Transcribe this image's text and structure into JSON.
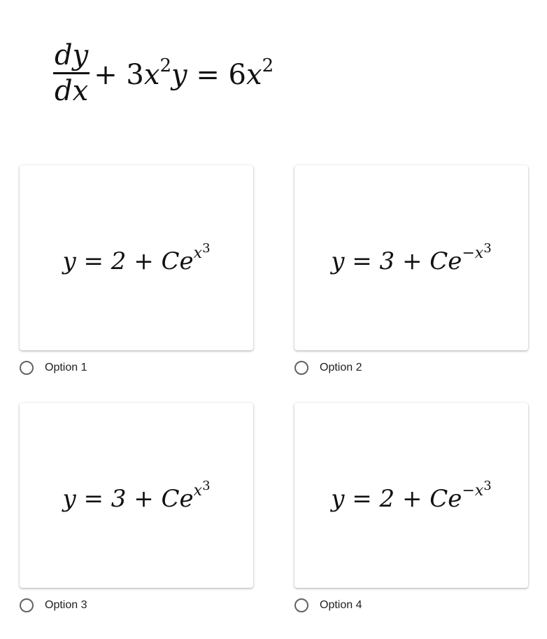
{
  "question": {
    "numerator": "dy",
    "denominator": "dx",
    "plus": "+ 3",
    "x1": "x",
    "exp1": "2",
    "y1": "y",
    "equals": " = 6",
    "x2": "x",
    "exp2": "2"
  },
  "options": [
    {
      "label": "Option 1",
      "formula_base": "y = 2 + Ce",
      "formula_exp_sign": "",
      "formula_exp_var": "x",
      "formula_exp_pow": "3",
      "selected": false
    },
    {
      "label": "Option 2",
      "formula_base": "y = 3 + Ce",
      "formula_exp_sign": "−",
      "formula_exp_var": "x",
      "formula_exp_pow": "3",
      "selected": false
    },
    {
      "label": "Option 3",
      "formula_base": "y = 3 + Ce",
      "formula_exp_sign": "",
      "formula_exp_var": "x",
      "formula_exp_pow": "3",
      "selected": false
    },
    {
      "label": "Option 4",
      "formula_base": "y = 2 + Ce",
      "formula_exp_sign": "−",
      "formula_exp_var": "x",
      "formula_exp_pow": "3",
      "selected": false
    }
  ],
  "colors": {
    "radio_border": "#5f6368",
    "label_text": "#202124"
  }
}
